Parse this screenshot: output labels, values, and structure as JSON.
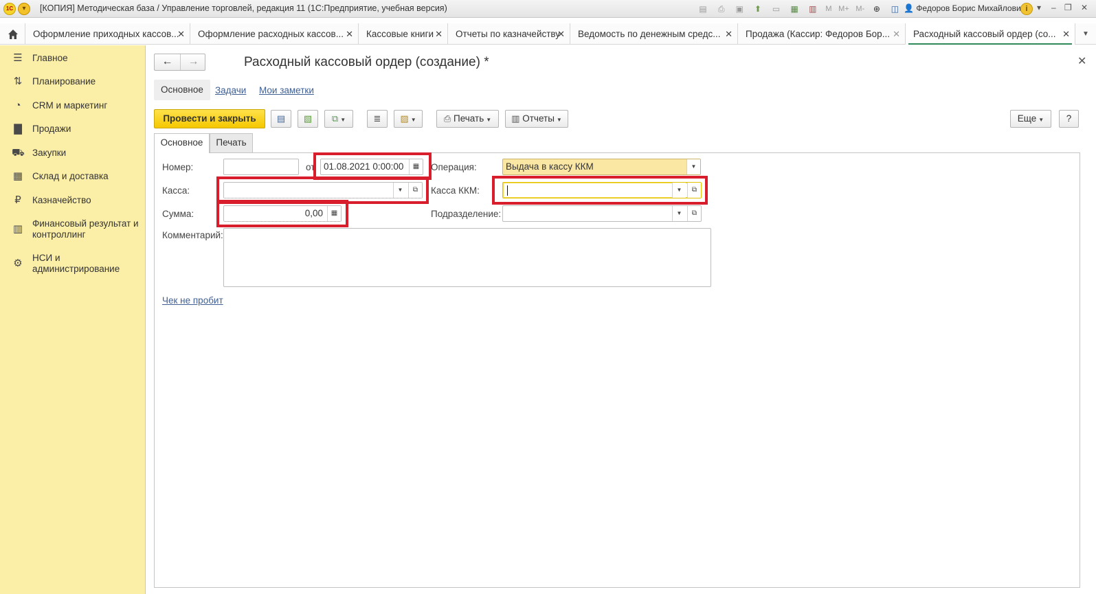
{
  "window": {
    "title": "[КОПИЯ] Методическая база / Управление торговлей, редакция 11  (1С:Предприятие, учебная версия)",
    "user": "Федоров Борис Михайлович",
    "logo": "1С",
    "toolbar_icons": [
      "save-icon",
      "print-icon",
      "preview-icon",
      "upload-icon",
      "doc-icon",
      "calculator-icon",
      "calendar-icon"
    ],
    "memory_labels": [
      "M",
      "M+",
      "M-"
    ]
  },
  "tabs": [
    {
      "label": "Оформление приходных кассов...",
      "active": false
    },
    {
      "label": "Оформление расходных кассов...",
      "active": false
    },
    {
      "label": "Кассовые книги",
      "active": false
    },
    {
      "label": "Отчеты по казначейству",
      "active": false
    },
    {
      "label": "Ведомость по денежным средс...",
      "active": false
    },
    {
      "label": "Продажа (Кассир: Федоров Бор...",
      "active": false
    },
    {
      "label": "Расходный кассовый ордер (со...",
      "active": true
    }
  ],
  "sidebar": {
    "items": [
      {
        "label": "Главное",
        "icon": "menu-icon"
      },
      {
        "label": "Планирование",
        "icon": "planning-icon"
      },
      {
        "label": "CRM и маркетинг",
        "icon": "crm-icon"
      },
      {
        "label": "Продажи",
        "icon": "bag-icon"
      },
      {
        "label": "Закупки",
        "icon": "cart-icon"
      },
      {
        "label": "Склад и доставка",
        "icon": "warehouse-icon"
      },
      {
        "label": "Казначейство",
        "icon": "ruble-icon"
      },
      {
        "label": "Финансовый результат и контроллинг",
        "icon": "chart-icon"
      },
      {
        "label": "НСИ и администрирование",
        "icon": "gear-icon"
      }
    ]
  },
  "form": {
    "title": "Расходный кассовый ордер (создание) *",
    "nav": {
      "main": "Основное",
      "tasks": "Задачи",
      "notes": "Мои заметки"
    },
    "commands": {
      "post_close": "Провести и закрыть",
      "print": "Печать",
      "reports": "Отчеты",
      "more": "Еще",
      "help": "?"
    },
    "inner_tabs": {
      "main": "Основное",
      "print": "Печать"
    },
    "fields": {
      "number_label": "Номер:",
      "number_value": "",
      "from_label": "от",
      "date_value": "01.08.2021  0:00:00",
      "operation_label": "Операция:",
      "operation_value": "Выдача в кассу ККМ",
      "cash_label": "Касса:",
      "cash_value": "",
      "kkm_label": "Касса ККМ:",
      "kkm_value": "",
      "sum_label": "Сумма:",
      "sum_value": "0,00",
      "dept_label": "Подразделение:",
      "dept_value": "",
      "comment_label": "Комментарий:",
      "comment_value": ""
    },
    "receipt_link": "Чек не пробит"
  },
  "highlight_color": "#d81e2c"
}
